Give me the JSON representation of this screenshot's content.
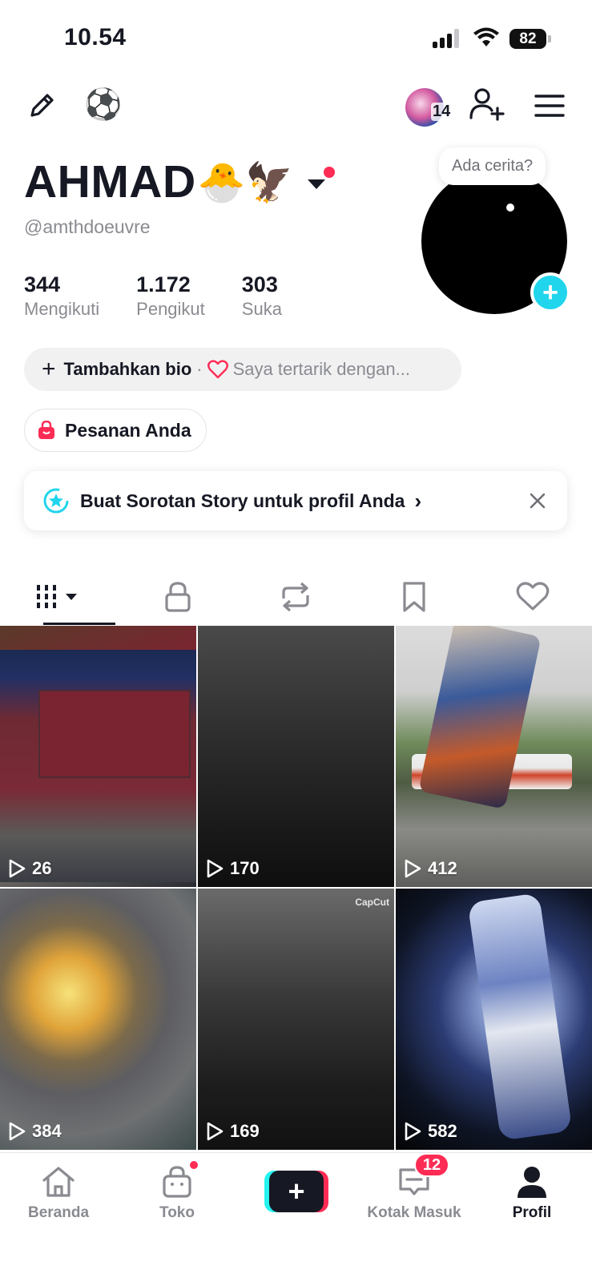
{
  "status_bar": {
    "time": "10.54",
    "battery": "82"
  },
  "top_bar": {
    "story_count": "14",
    "top_emoji": "⚽"
  },
  "profile": {
    "name": "AHMAD",
    "name_emoji": "🐣🦅",
    "username": "@amthdoeuvre",
    "story_prompt": "Ada cerita?",
    "stats": [
      {
        "value": "344",
        "label": "Mengikuti"
      },
      {
        "value": "1.172",
        "label": "Pengikut"
      },
      {
        "value": "303",
        "label": "Suka"
      }
    ]
  },
  "bio": {
    "add_label": "Tambahkan bio",
    "separator": "·",
    "interest_hint": "Saya tertarik dengan..."
  },
  "orders": {
    "label": "Pesanan Anda"
  },
  "story_banner": {
    "text": "Buat Sorotan Story untuk profil Anda",
    "chevron": "›"
  },
  "tabs": [
    "videos",
    "private",
    "reposts",
    "saved",
    "liked"
  ],
  "videos": [
    {
      "views": "26"
    },
    {
      "views": "170"
    },
    {
      "views": "412"
    },
    {
      "views": "384"
    },
    {
      "views": "169",
      "watermark": "CapCut"
    },
    {
      "views": "582"
    }
  ],
  "bottom_nav": {
    "items": [
      {
        "label": "Beranda"
      },
      {
        "label": "Toko"
      },
      {
        "label": "Kotak Masuk",
        "badge": "12"
      },
      {
        "label": "Profil"
      }
    ]
  },
  "colors": {
    "accent": "#fe2c55",
    "cyan": "#20d5ec",
    "text": "#161823",
    "muted": "#8a8b91"
  }
}
